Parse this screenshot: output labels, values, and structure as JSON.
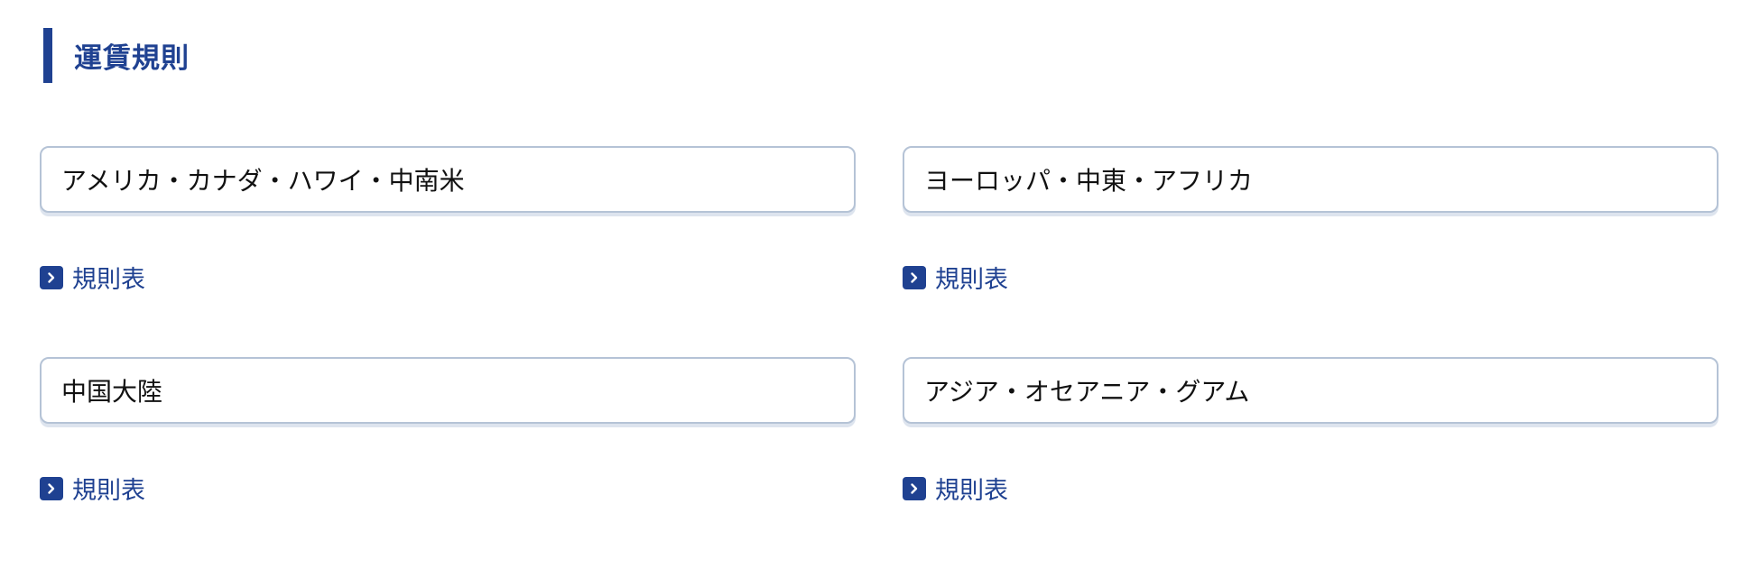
{
  "section": {
    "title": "運賃規則"
  },
  "colors": {
    "accent": "#1f4191",
    "box_border": "#b5c3d6",
    "text": "#111111"
  },
  "regions": [
    {
      "name": "アメリカ・カナダ・ハワイ・中南米",
      "link_label": "規則表",
      "link_icon": "chevron-right-icon"
    },
    {
      "name": "ヨーロッパ・中東・アフリカ",
      "link_label": "規則表",
      "link_icon": "chevron-right-icon"
    },
    {
      "name": "中国大陸",
      "link_label": "規則表",
      "link_icon": "chevron-right-icon"
    },
    {
      "name": "アジア・オセアニア・グアム",
      "link_label": "規則表",
      "link_icon": "chevron-right-icon"
    }
  ]
}
